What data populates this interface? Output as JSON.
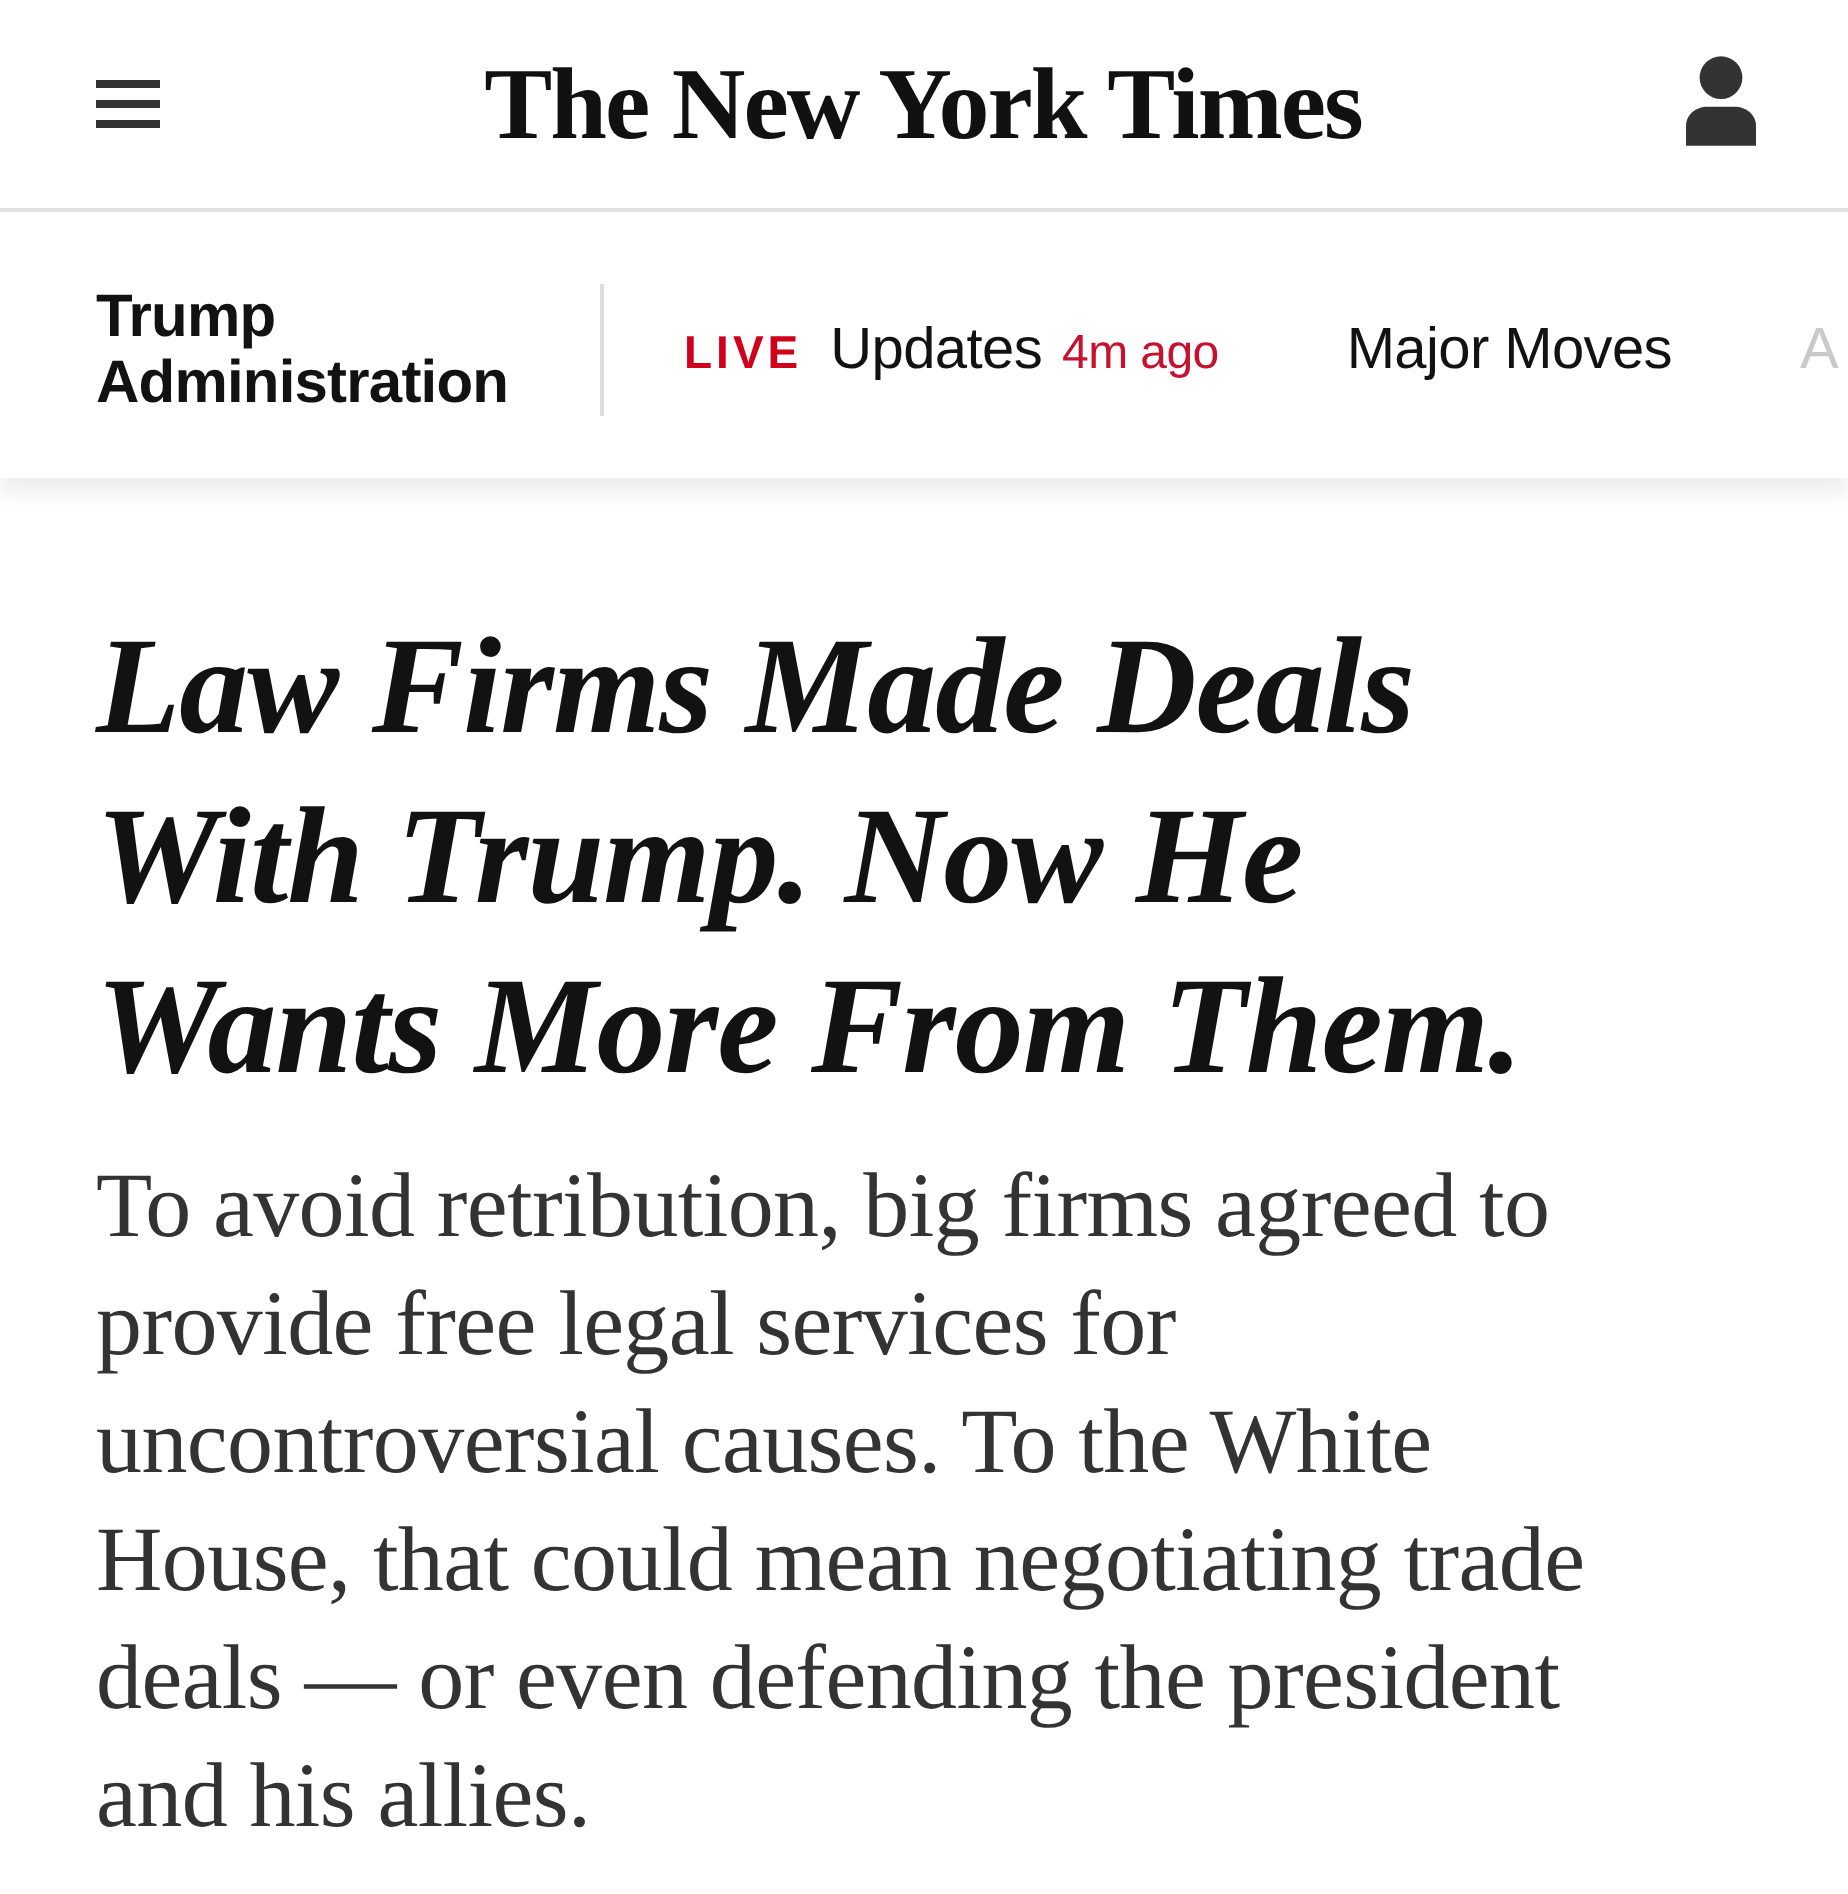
{
  "header": {
    "logo": "The New York Times"
  },
  "nav": {
    "section": "Trump Administration",
    "items": [
      {
        "kind": "live",
        "badge": "LIVE",
        "label": "Updates",
        "time": "4m ago",
        "faded": false
      },
      {
        "kind": "link",
        "label": "Major Moves",
        "faded": false
      },
      {
        "kind": "link",
        "label": "A",
        "faded": true
      }
    ]
  },
  "headline": "Law Firms Made Deals With Trump. Now He Wants More From Them.",
  "summary": "To avoid retribution, big firms agreed to provide free legal services for uncontroversial causes. To the White House, that could mean negotiating trade deals — or even defending the president and his allies."
}
